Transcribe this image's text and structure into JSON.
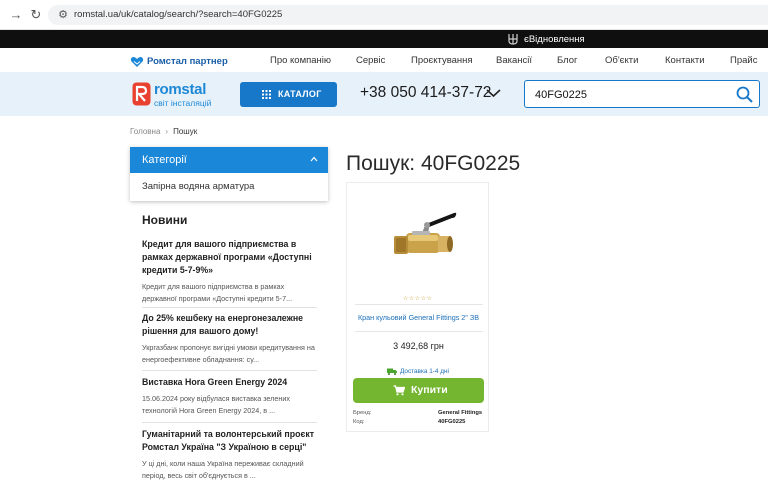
{
  "browser": {
    "url": "romstal.ua/uk/catalog/search/?search=40FG0225"
  },
  "top_bar": {
    "restore_label": "єВідновлення"
  },
  "top_menu": {
    "partner_label": "Ромстал партнер",
    "items": [
      "Про компанію",
      "Сервіс",
      "Проєктування",
      "Вакансії",
      "Блог",
      "Об'єкти",
      "Контакти",
      "Прайс"
    ]
  },
  "header": {
    "logo_brand": "romstal",
    "logo_tagline": "світ інсталяцій",
    "catalog_label": "КАТАЛОГ",
    "phone": "+38 050 414-37-72",
    "search_value": "40FG0225"
  },
  "breadcrumb": {
    "home": "Головна",
    "current": "Пошук"
  },
  "categories": {
    "title": "Категорії",
    "items": [
      "Запірна водяна арматура"
    ]
  },
  "news": {
    "title": "Новини",
    "items": [
      {
        "title": "Кредит для вашого підприємства в рамках державної програми «Доступні кредити 5-7-9%»",
        "desc": "Кредит для вашого підприємства в рамках державної програми «Доступні кредити 5-7..."
      },
      {
        "title": "До 25% кешбеку на енергонезалежне рішення для вашого дому!",
        "desc": "Укргазбанк пропонує вигідні умови кредитування на енергоефективне обладнання: су..."
      },
      {
        "title": "Виставка Hora Green Energy 2024",
        "desc": "15.06.2024 року відбулася виставка зелених технологій Hora Green Energy 2024, в ..."
      },
      {
        "title": "Гуманітарний та волонтерський проєкт Ромстал Україна \"З Україною в серці\"",
        "desc": "У ці дні, коли наша Україна переживає складний період, весь світ об'єднується в ..."
      }
    ]
  },
  "search_page": {
    "title": "Пошук: 40FG0225"
  },
  "product": {
    "name": "Кран кульовий General Fittings 2\" ЗВ",
    "rating": 0,
    "price": "3 492,68 грн",
    "delivery": "Доставка 1-4 дні",
    "buy_label": "Купити",
    "specs": [
      {
        "label": "Бренд:",
        "value": "General Fittings"
      },
      {
        "label": "Код:",
        "value": "40FG0225"
      }
    ]
  },
  "colors": {
    "brand_blue": "#1b87d8",
    "buy_green": "#74b62f",
    "header_bg": "#e7f1fa"
  }
}
